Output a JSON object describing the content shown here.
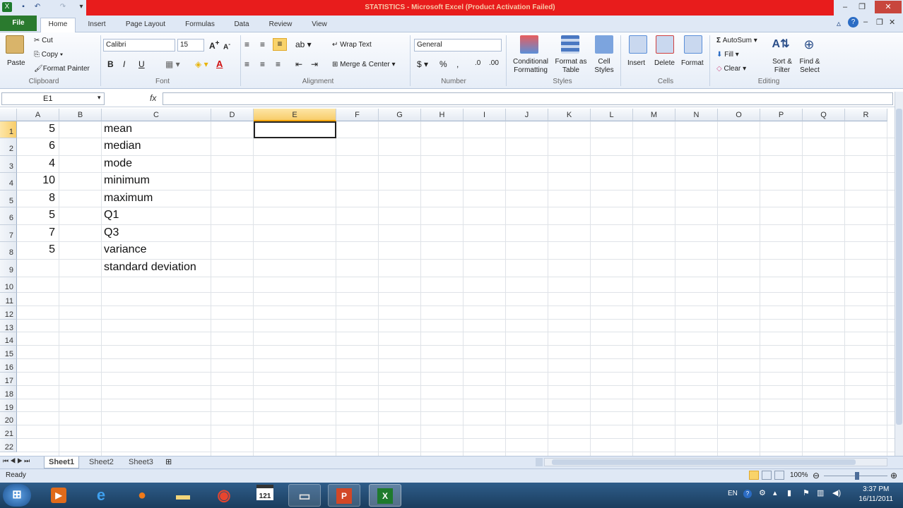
{
  "window": {
    "title": "STATISTICS - Microsoft Excel (Product Activation Failed)"
  },
  "tabs": [
    "File",
    "Home",
    "Insert",
    "Page Layout",
    "Formulas",
    "Data",
    "Review",
    "View"
  ],
  "ribbon": {
    "clipboard": {
      "paste": "Paste",
      "cut": "Cut",
      "copy": "Copy",
      "format_painter": "Format Painter",
      "label": "Clipboard"
    },
    "font": {
      "name": "Calibri",
      "size": "15",
      "label": "Font"
    },
    "alignment": {
      "wrap_text": "Wrap Text",
      "merge_center": "Merge & Center",
      "label": "Alignment"
    },
    "number": {
      "format": "General",
      "label": "Number"
    },
    "styles": {
      "conditional": "Conditional Formatting",
      "format_table": "Format as Table",
      "cell_styles": "Cell Styles",
      "label": "Styles"
    },
    "cells": {
      "insert": "Insert",
      "delete": "Delete",
      "format": "Format",
      "label": "Cells"
    },
    "editing": {
      "autosum": "AutoSum",
      "fill": "Fill",
      "clear": "Clear",
      "sort_filter": "Sort & Filter",
      "find_select": "Find & Select",
      "label": "Editing"
    }
  },
  "formula_bar": {
    "name_box": "E1",
    "fx": "fx",
    "content": ""
  },
  "columns": [
    "A",
    "B",
    "C",
    "D",
    "E",
    "F",
    "G",
    "H",
    "I",
    "J",
    "K",
    "L",
    "M",
    "N",
    "O",
    "P",
    "Q",
    "R"
  ],
  "rows": [
    "1",
    "2",
    "3",
    "4",
    "5",
    "6",
    "7",
    "8",
    "9",
    "10",
    "11",
    "12",
    "13",
    "14",
    "15",
    "16",
    "17",
    "18",
    "19",
    "20",
    "21",
    "22"
  ],
  "cells": {
    "A": [
      "5",
      "6",
      "4",
      "10",
      "8",
      "5",
      "7",
      "5"
    ],
    "C": [
      "mean",
      "median",
      "mode",
      "minimum",
      "maximum",
      "Q1",
      "Q3",
      "variance",
      "standard deviation"
    ]
  },
  "sheets": [
    "Sheet1",
    "Sheet2",
    "Sheet3"
  ],
  "status": {
    "text": "Ready",
    "zoom": "100%"
  },
  "taskbar": {
    "lang": "EN",
    "time": "3:37 PM",
    "date": "16/11/2011",
    "calendar_icon_text": "121"
  }
}
